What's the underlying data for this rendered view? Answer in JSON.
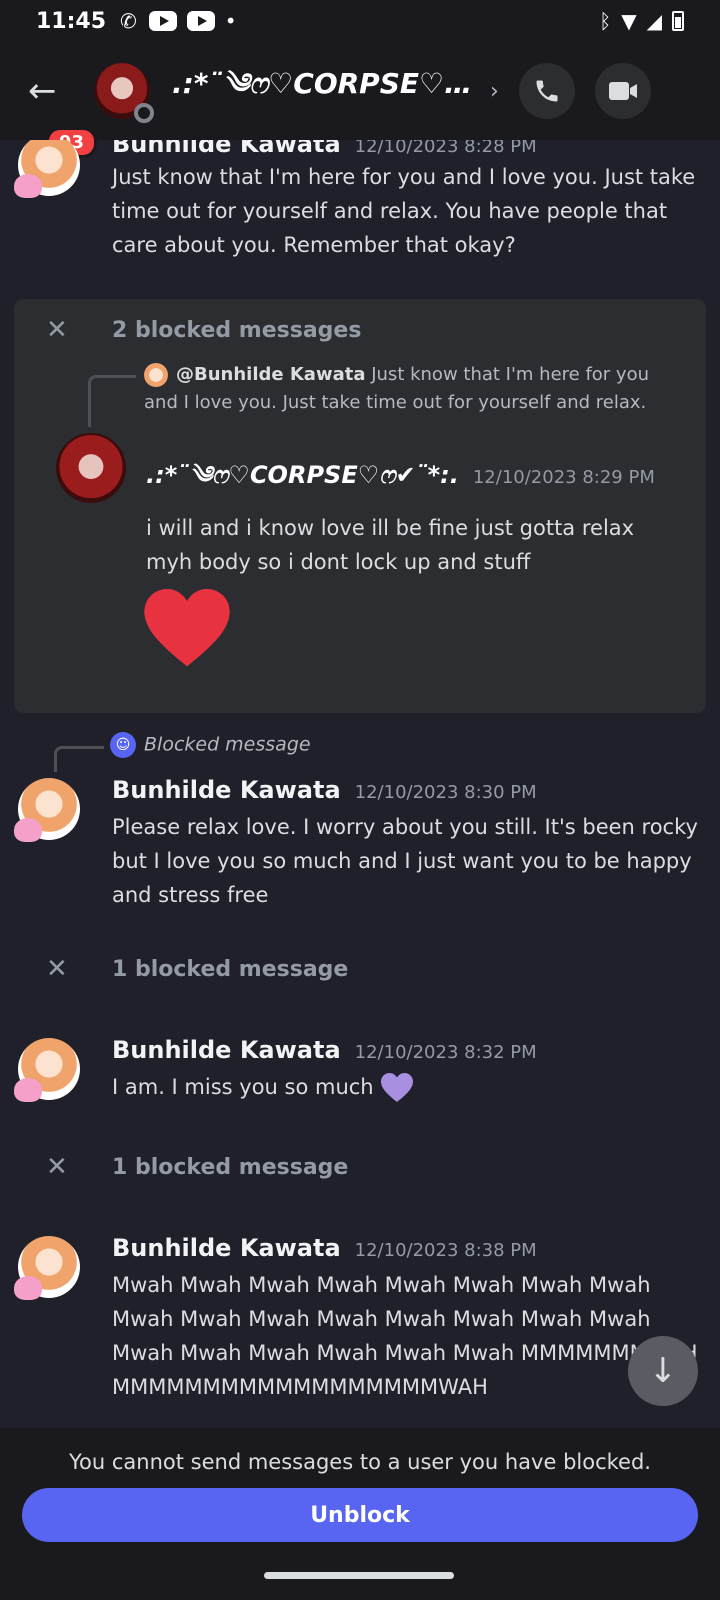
{
  "status_bar": {
    "time": "11:45"
  },
  "header": {
    "unread_badge": "93",
    "title": ".:*¨༄ෆ♡CORPSE♡…"
  },
  "messages": {
    "m1": {
      "author": "Bunhilde Kawata",
      "timestamp": "12/10/2023 8:28 PM",
      "text": "Just know that I'm here for you and I love you. Just take time out for yourself and relax. You have people that care about you. Remember that okay?"
    },
    "blocked_group_1": {
      "label": "2 blocked messages",
      "reply_author": "@Bunhilde Kawata",
      "reply_snippet": "Just know that I'm here for you and I love you. Just take time out for yourself and relax.",
      "author": ".:*¨༄ෆ♡CORPSE♡ෆ✔¨*:.",
      "timestamp": "12/10/2023 8:29 PM",
      "text": "i will and i know love ill be fine just gotta relax myh body so i dont lock up and stuff"
    },
    "m2": {
      "reply_ref": "Blocked message",
      "author": "Bunhilde Kawata",
      "timestamp": "12/10/2023 8:30 PM",
      "text": "Please relax love. I worry about you still. It's been rocky but I love you so much and I just want you to be happy and stress free"
    },
    "blocked_2": {
      "label": "1 blocked message"
    },
    "m3": {
      "author": "Bunhilde Kawata",
      "timestamp": "12/10/2023 8:32 PM",
      "text": "I am. I miss you so much"
    },
    "blocked_3": {
      "label": "1 blocked message"
    },
    "m4": {
      "author": "Bunhilde Kawata",
      "timestamp": "12/10/2023 8:38 PM",
      "text": "Mwah Mwah Mwah Mwah Mwah Mwah Mwah Mwah Mwah Mwah Mwah Mwah Mwah Mwah Mwah Mwah Mwah Mwah Mwah Mwah Mwah Mwah MMMMMMMWAH MMMMMMMMMMMMMMMMMMWAH"
    }
  },
  "footer": {
    "note": "You cannot send messages to a user you have blocked.",
    "unblock_label": "Unblock"
  },
  "colors": {
    "accent": "#5865f2",
    "badge": "#f23f43",
    "heart": "#e8323f",
    "purple_heart": "#a98fe0"
  },
  "icons": [
    "back-arrow-icon",
    "phone-icon",
    "video-icon",
    "close-icon",
    "discord-icon",
    "arrow-down-icon"
  ]
}
